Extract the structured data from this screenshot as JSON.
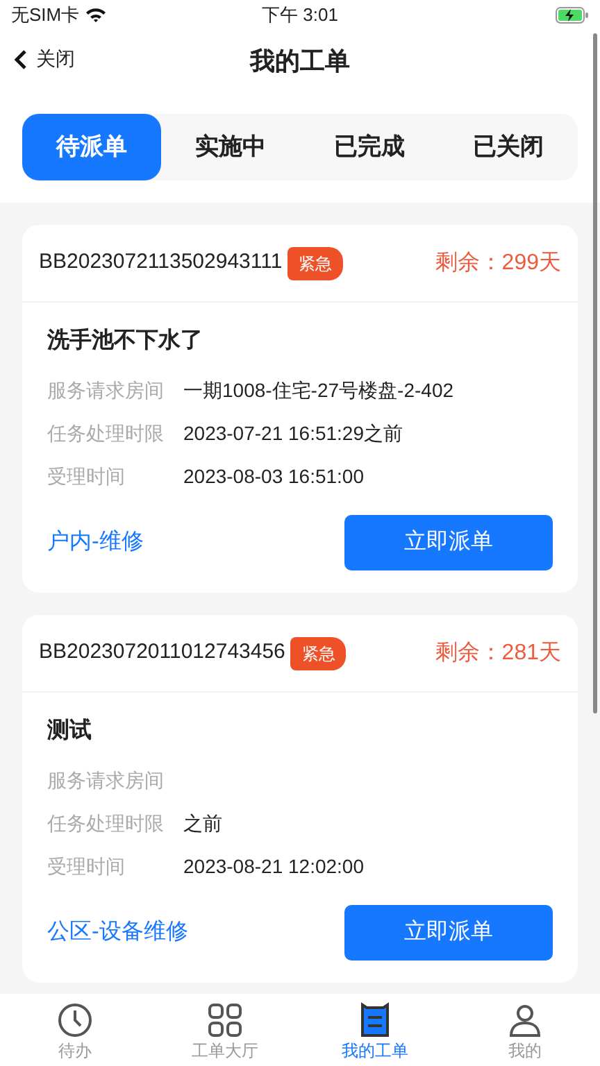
{
  "status_bar": {
    "carrier": "无SIM卡",
    "time": "下午 3:01",
    "charging": true
  },
  "nav": {
    "back": "关闭",
    "title": "我的工单"
  },
  "tabs": [
    {
      "label": "待派单",
      "selected": true
    },
    {
      "label": "实施中",
      "selected": false
    },
    {
      "label": "已完成",
      "selected": false
    },
    {
      "label": "已关闭",
      "selected": false
    }
  ],
  "orders": [
    {
      "number": "BB2023072113502943111",
      "tag": "紧急",
      "remaining": "剩余：299天",
      "title": "洗手池不下水了",
      "fields": [
        {
          "label": "服务请求房间",
          "value": "一期1008-住宅-27号楼盘-2-402"
        },
        {
          "label": "任务处理时限",
          "value": "2023-07-21 16:51:29之前"
        },
        {
          "label": "受理时间",
          "value": "2023-08-03 16:51:00"
        }
      ],
      "category": "户内-维修",
      "action": "立即派单"
    },
    {
      "number": "BB2023072011012743456",
      "tag": "紧急",
      "remaining": "剩余：281天",
      "title": "测试",
      "fields": [
        {
          "label": "服务请求房间"
        },
        {
          "label": "任务处理时限",
          "value": "之前"
        },
        {
          "label": "受理时间",
          "value": "2023-08-21 12:02:00"
        }
      ],
      "category": "公区-设备维修",
      "action": "立即派单"
    }
  ],
  "tab_bar": [
    {
      "label": "待办",
      "kind": "clock",
      "selected": false
    },
    {
      "label": "工单大厅",
      "kind": "grid",
      "selected": false
    },
    {
      "label": "我的工单",
      "kind": "doc",
      "selected": true
    },
    {
      "label": "我的",
      "kind": "person",
      "selected": false
    }
  ]
}
